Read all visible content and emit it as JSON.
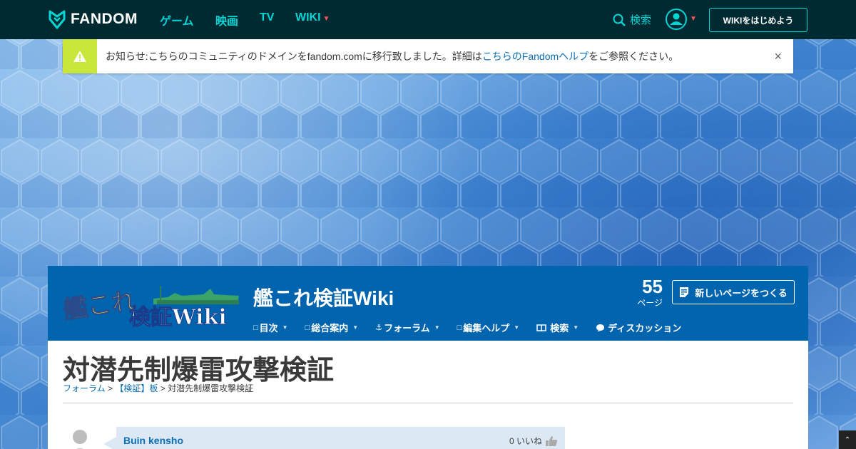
{
  "topnav": {
    "brand": "FANDOM",
    "links": [
      "ゲーム",
      "映画",
      "TV",
      "WIKI"
    ],
    "search_label": "検索",
    "start_wiki": "WIKIをはじめよう"
  },
  "notice": {
    "text_before": "お知らせ:こちらのコミュニティのドメインをfandom.comに移行致しました。詳細は",
    "link": "こちらのFandomヘルプ",
    "text_after": "をご参照ください。",
    "close": "×"
  },
  "wiki": {
    "title": "艦これ検証Wiki",
    "logo_text_top": "艦これ",
    "logo_text_bottom": "検証Wiki",
    "page_count": "55",
    "page_count_label": "ページ",
    "new_page": "新しいページをつくる",
    "nav": [
      {
        "label": "目次"
      },
      {
        "label": "総合案内"
      },
      {
        "label": "フォーラム"
      },
      {
        "label": "編集ヘルプ"
      },
      {
        "label": "検索"
      },
      {
        "label": "ディスカッション"
      }
    ]
  },
  "page": {
    "title": "対潜先制爆雷攻撃検証",
    "breadcrumb": {
      "forum": "フォーラム",
      "sep1": ">",
      "board": "【検証】板",
      "sep2": ">",
      "current": "対潜先制爆雷攻撃検証"
    },
    "post": {
      "author": "Buin kensho",
      "likes": "0 いいね"
    }
  },
  "colors": {
    "nav_bg": "#002a32",
    "accent": "#00d6d6",
    "wiki_header_bg": "#0064ae",
    "notice_icon_bg": "#c9e63b",
    "link": "#0a6eb4"
  }
}
